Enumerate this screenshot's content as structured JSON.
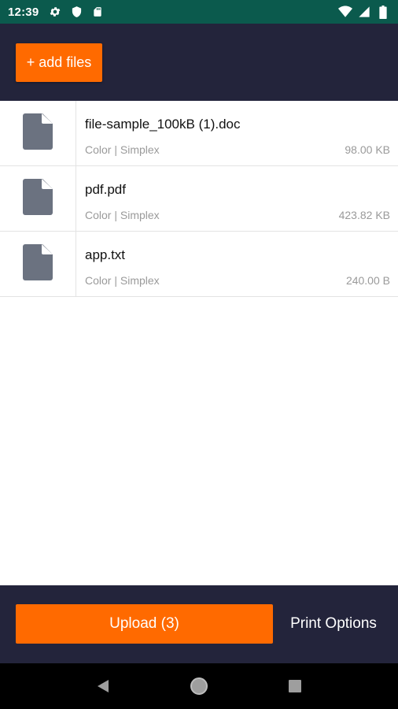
{
  "status_bar": {
    "time": "12:39",
    "left_icons": [
      "gear-icon",
      "shield-icon",
      "sd-card-icon"
    ],
    "right_icons": [
      "wifi-icon",
      "signal-icon",
      "battery-icon"
    ],
    "background": "#0b5a4d"
  },
  "header": {
    "add_files_label": "+ add files",
    "background": "#23243b",
    "accent": "#ff6a00"
  },
  "files": [
    {
      "name": "file-sample_100kB (1).doc",
      "meta": "Color | Simplex",
      "size": "98.00 KB",
      "icon": "file-icon"
    },
    {
      "name": "pdf.pdf",
      "meta": "Color | Simplex",
      "size": "423.82 KB",
      "icon": "file-icon"
    },
    {
      "name": "app.txt",
      "meta": "Color | Simplex",
      "size": "240.00 B",
      "icon": "file-icon"
    }
  ],
  "bottom_bar": {
    "upload_label": "Upload (3)",
    "print_options_label": "Print Options"
  },
  "nav_bar": {
    "buttons": [
      "back-icon",
      "home-icon",
      "recents-icon"
    ]
  }
}
